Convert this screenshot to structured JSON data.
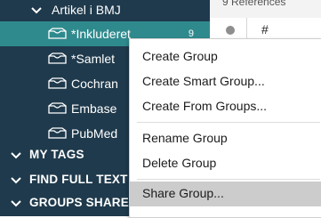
{
  "sidebar": {
    "group": {
      "label": "Artikel i BMJ"
    },
    "items": [
      {
        "label": "*Inkluderet",
        "count": "9"
      },
      {
        "label": "*Samlet"
      },
      {
        "label": "Cochran"
      },
      {
        "label": "Embase"
      },
      {
        "label": "PubMed"
      }
    ],
    "sections": [
      {
        "label": "MY TAGS"
      },
      {
        "label": "FIND FULL TEXT"
      },
      {
        "label": "GROUPS SHARED BY OTHERS"
      }
    ]
  },
  "content": {
    "references_label": "9 References",
    "column_number_header": "#"
  },
  "context_menu": {
    "items": [
      {
        "label": "Create Group"
      },
      {
        "label": "Create Smart Group..."
      },
      {
        "label": "Create From Groups..."
      },
      {
        "label": "Rename Group"
      },
      {
        "label": "Delete Group"
      },
      {
        "label": "Share Group..."
      }
    ],
    "highlighted_item": "Share Group..."
  },
  "colors": {
    "sidebar_bg": "#1f3a4c",
    "active_row_bg": "#2f8a8d",
    "menu_highlight": "#cccccc"
  }
}
